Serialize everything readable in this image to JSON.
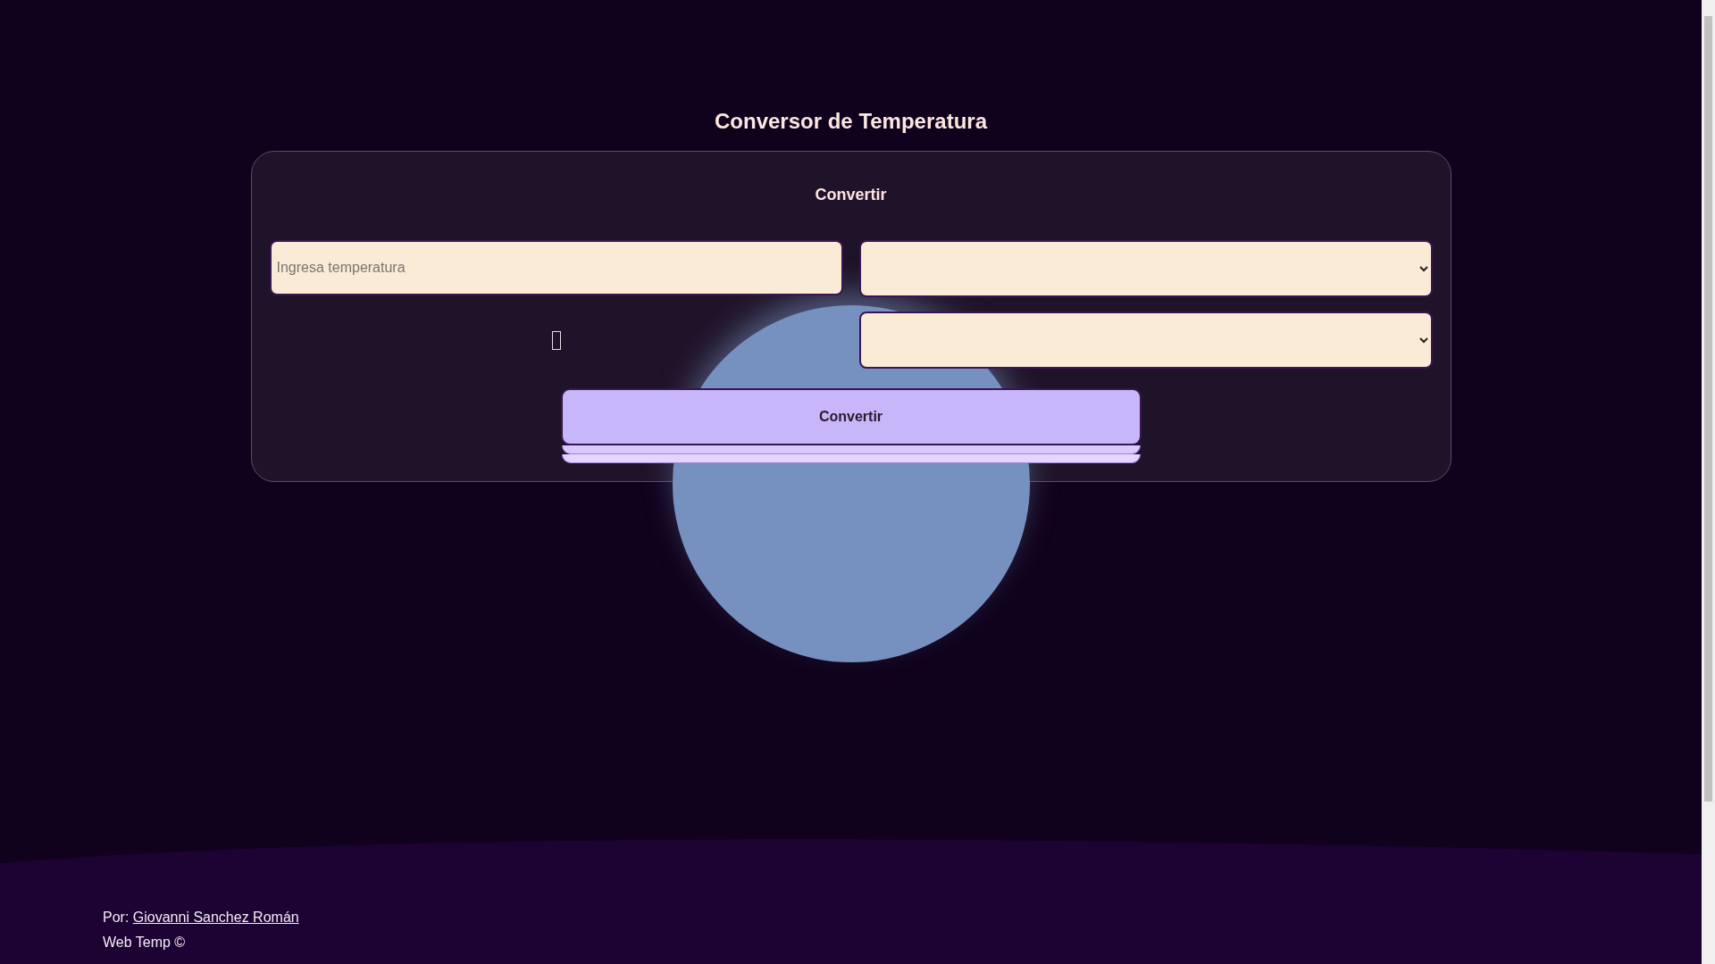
{
  "title": "Conversor de Temperatura",
  "form": {
    "heading": "Convertir",
    "temperature_input": {
      "placeholder": "Ingresa temperatura"
    },
    "convert_button": "Convertir"
  },
  "footer": {
    "author_prefix": "Por:",
    "author_link": "Giovanni Sanchez Román",
    "copyright": "Web Temp ©"
  }
}
